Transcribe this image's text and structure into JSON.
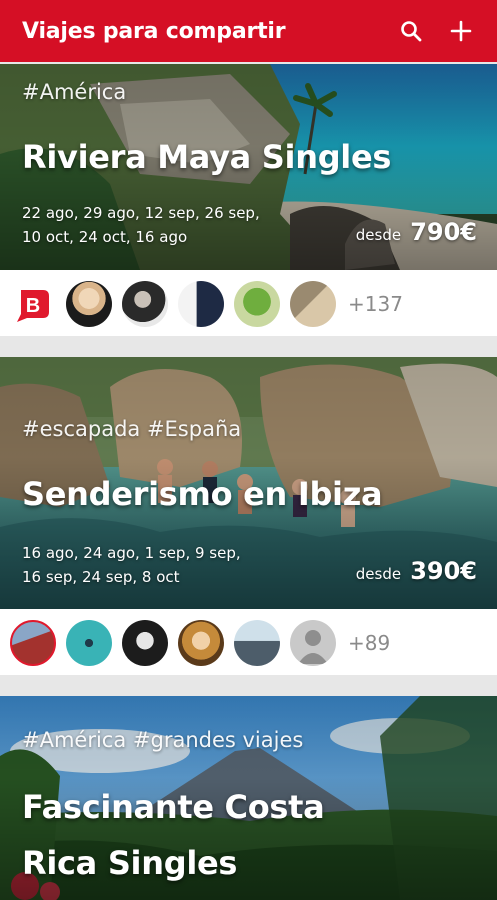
{
  "app_bar": {
    "title": "Viajes para compartir",
    "search_icon": "search-icon",
    "add_icon": "plus-icon",
    "color": "#d50f25"
  },
  "trips": [
    {
      "tags": "#América",
      "name": "Riviera Maya Singles",
      "dates": "22 ago, 29 ago, 12 sep, 26 sep, 10 oct, 24 oct, 16 ago",
      "price_prefix": "desde",
      "price": "790€",
      "more_count": "+137"
    },
    {
      "tags": "#escapada #España",
      "name": "Senderismo en Ibiza",
      "dates": "16 ago, 24 ago, 1 sep, 9 sep, 16 sep, 24 sep, 8 oct",
      "price_prefix": "desde",
      "price": "390€",
      "more_count": "+89"
    },
    {
      "tags": "#América #grandes viajes",
      "name_line1": "Fascinante Costa",
      "name_line2": "Rica Singles"
    }
  ],
  "brand_color": "#e0192d"
}
